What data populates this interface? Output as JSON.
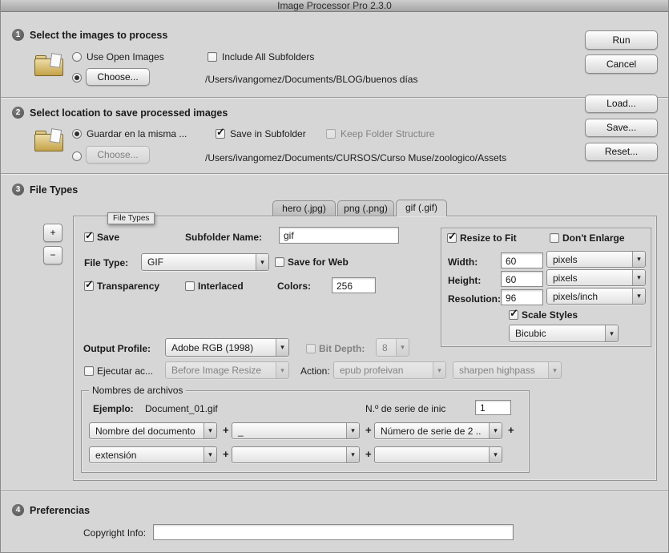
{
  "icons": {
    "dropdown_arrow": "▾"
  },
  "window": {
    "title": "Image Processor Pro 2.3.0"
  },
  "buttons": {
    "run": "Run",
    "cancel": "Cancel",
    "load": "Load...",
    "save": "Save...",
    "reset": "Reset...",
    "plus": "+",
    "minus": "−"
  },
  "section1": {
    "number": "1",
    "title": "Select the images to process",
    "use_open_images": "Use Open Images",
    "include_all_subfolders": "Include All Subfolders",
    "choose": "Choose...",
    "path": "/Users/ivangomez/Documents/BLOG/buenos días"
  },
  "section2": {
    "number": "2",
    "title": "Select location to save processed images",
    "save_same_location": "Guardar en la misma ...",
    "save_in_subfolder": "Save in Subfolder",
    "keep_folder_structure": "Keep Folder Structure",
    "choose": "Choose...",
    "path": "/Users/ivangomez/Documents/CURSOS/Curso Muse/zoologico/Assets"
  },
  "section3": {
    "number": "3",
    "title": "File Types",
    "tabs": [
      {
        "label": "hero (.jpg)"
      },
      {
        "label": "png (.png)"
      },
      {
        "label": "gif (.gif)"
      }
    ],
    "tooltip": "File Types",
    "save": "Save",
    "subfolder_name_label": "Subfolder Name:",
    "subfolder_name_value": "gif",
    "file_type_label": "File Type:",
    "file_type_value": "GIF",
    "save_for_web": "Save for Web",
    "transparency": "Transparency",
    "interlaced": "Interlaced",
    "colors_label": "Colors:",
    "colors_value": "256",
    "resize": {
      "resize_to_fit": "Resize to Fit",
      "dont_enlarge": "Don't Enlarge",
      "width_label": "Width:",
      "width_value": "60",
      "width_unit": "pixels",
      "height_label": "Height:",
      "height_value": "60",
      "height_unit": "pixels",
      "resolution_label": "Resolution:",
      "resolution_value": "96",
      "resolution_unit": "pixels/inch",
      "scale_styles": "Scale Styles",
      "interpolation": "Bicubic"
    },
    "output_profile_label": "Output Profile:",
    "output_profile_value": "Adobe RGB (1998)",
    "bit_depth_label": "Bit Depth:",
    "bit_depth_value": "8",
    "run_action_label": "Ejecutar ac...",
    "run_action_timing": "Before Image Resize",
    "action_label": "Action:",
    "action_set": "epub profeivan",
    "action_name": "sharpen highpass",
    "filenames": {
      "legend": "Nombres de archivos",
      "example_label": "Ejemplo:",
      "example_value": "Document_01.gif",
      "serial_label": "N.º de serie de inic",
      "serial_value": "1",
      "plus": "+",
      "row1": [
        "Nombre del documento",
        "_",
        "Número de serie de 2 .."
      ],
      "row2": [
        "extensión",
        "",
        ""
      ]
    }
  },
  "section4": {
    "number": "4",
    "title": "Preferencias",
    "copyright_label": "Copyright Info:",
    "copyright_value": ""
  }
}
